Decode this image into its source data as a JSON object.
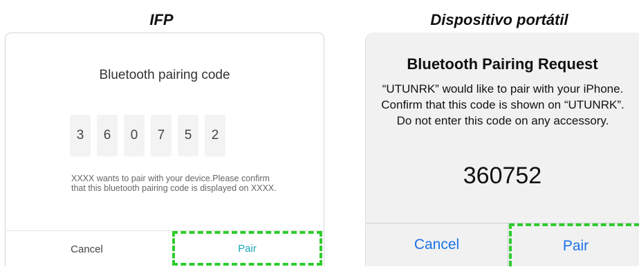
{
  "headings": {
    "left": "IFP",
    "right": "Dispositivo portátil"
  },
  "ifp": {
    "title": "Bluetooth pairing code",
    "code_digits": [
      "3",
      "6",
      "0",
      "7",
      "5",
      "2"
    ],
    "description": "XXXX wants to pair with your device.Please confirm that this bluetooth pairing code is displayed on XXXX.",
    "cancel_label": "Cancel",
    "pair_label": "Pair"
  },
  "ios": {
    "title": "Bluetooth Pairing Request",
    "message": "“UTUNRK” would like to pair with your iPhone. Confirm that this code is shown on “UTUNRK”. Do not enter this code on any accessory.",
    "code": "360752",
    "cancel_label": "Cancel",
    "pair_label": "Pair"
  },
  "colors": {
    "highlight_dash": "#2ecc2e",
    "ifp_accent": "#1aa6b7",
    "ios_accent": "#1b73e8"
  }
}
